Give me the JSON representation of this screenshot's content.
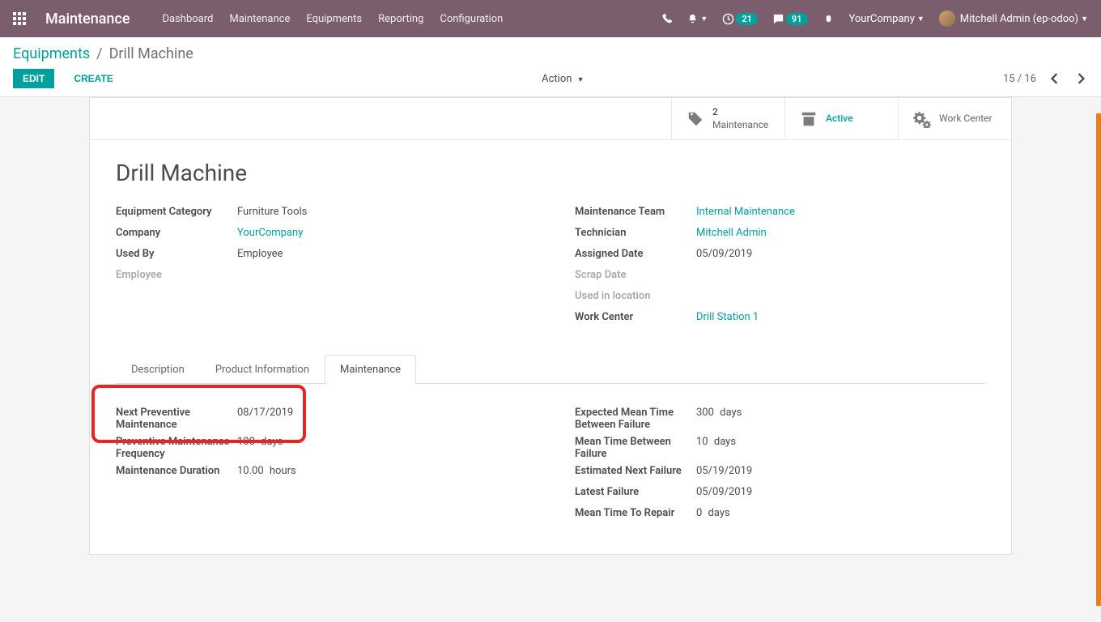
{
  "nav": {
    "app_title": "Maintenance",
    "items": [
      "Dashboard",
      "Maintenance",
      "Equipments",
      "Reporting",
      "Configuration"
    ],
    "badge_activities": "21",
    "badge_messages": "91",
    "company": "YourCompany",
    "user": "Mitchell Admin (ep-odoo)"
  },
  "breadcrumb": {
    "parent": "Equipments",
    "current": "Drill Machine"
  },
  "buttons": {
    "edit": "EDIT",
    "create": "CREATE",
    "action": "Action"
  },
  "pager": {
    "text": "15 / 16"
  },
  "stat": {
    "maint_count": "2",
    "maint_label": "Maintenance",
    "active": "Active",
    "work_center": "Work Center"
  },
  "record": {
    "title": "Drill Machine",
    "left": {
      "category_label": "Equipment Category",
      "category_value": "Furniture Tools",
      "company_label": "Company",
      "company_value": "YourCompany",
      "usedby_label": "Used By",
      "usedby_value": "Employee",
      "employee_label": "Employee"
    },
    "right": {
      "team_label": "Maintenance Team",
      "team_value": "Internal Maintenance",
      "tech_label": "Technician",
      "tech_value": "Mitchell Admin",
      "assigned_label": "Assigned Date",
      "assigned_value": "05/09/2019",
      "scrap_label": "Scrap Date",
      "location_label": "Used in location",
      "wc_label": "Work Center",
      "wc_value": "Drill Station 1"
    }
  },
  "tabs": {
    "description": "Description",
    "product_info": "Product Information",
    "maintenance": "Maintenance"
  },
  "maint_tab": {
    "left": {
      "next_pm_label": "Next Preventive Maintenance",
      "next_pm_value": "08/17/2019",
      "freq_label": "Preventive Maintenance Frequency",
      "freq_value": "100",
      "freq_unit": "days",
      "duration_label": "Maintenance Duration",
      "duration_value": "10.00",
      "duration_unit": "hours"
    },
    "right": {
      "expected_mtbf_label": "Expected Mean Time Between Failure",
      "expected_mtbf_value": "300",
      "expected_mtbf_unit": "days",
      "mtbf_label": "Mean Time Between Failure",
      "mtbf_value": "10",
      "mtbf_unit": "days",
      "next_fail_label": "Estimated Next Failure",
      "next_fail_value": "05/19/2019",
      "latest_fail_label": "Latest Failure",
      "latest_fail_value": "05/09/2019",
      "mttr_label": "Mean Time To Repair",
      "mttr_value": "0",
      "mttr_unit": "days"
    }
  }
}
